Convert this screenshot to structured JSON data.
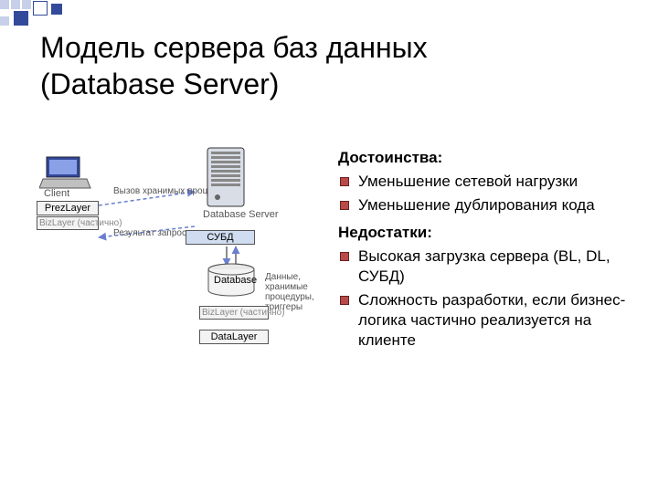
{
  "title_line1": "Модель сервера баз данных",
  "title_line2": "(Database Server)",
  "diagram": {
    "client_label": "Client",
    "prez": "PrezLayer",
    "biz_partial": "BizLayer (частично)",
    "call_text": "Вызов хранимых процедур",
    "result_text": "Результат запроса",
    "server_label": "Database Server",
    "subd": "СУБД",
    "database": "Database",
    "data_text": "Данные, хранимые процедуры, триггеры",
    "datalayer": "DataLayer"
  },
  "right": {
    "pros_header": "Достоинства:",
    "pros": [
      "Уменьшение сетевой нагрузки",
      "Уменьшение дублирования кода"
    ],
    "cons_header": "Недостатки:",
    "cons": [
      "Высокая загрузка сервера (BL, DL, СУБД)",
      "Сложность разработки, если бизнес-логика частично реализуется на клиенте"
    ]
  }
}
